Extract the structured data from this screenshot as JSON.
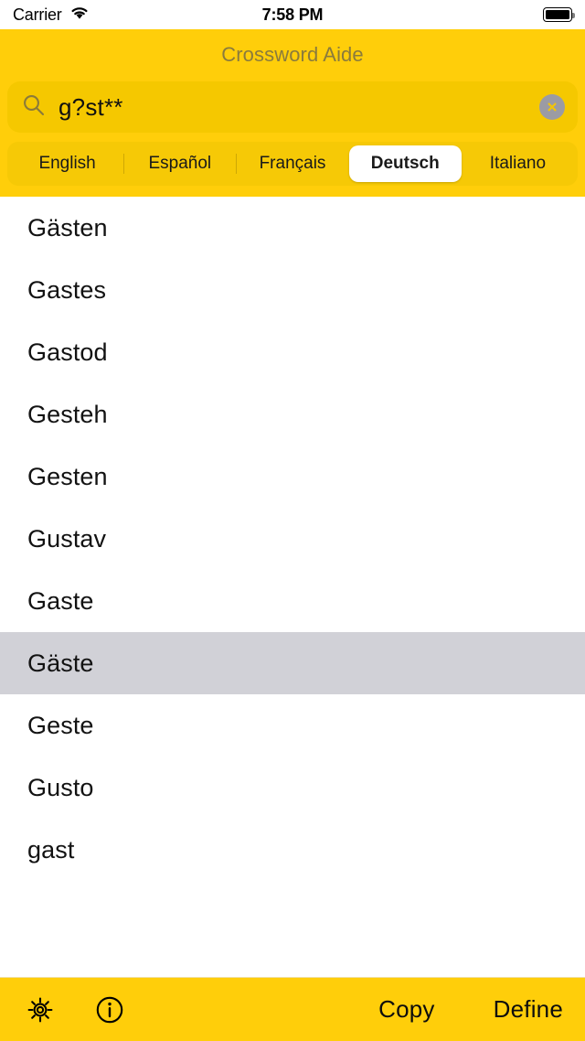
{
  "status_bar": {
    "carrier": "Carrier",
    "wifi_icon": "wifi-icon",
    "time": "7:58 PM",
    "battery_icon": "battery-full-icon"
  },
  "header": {
    "title": "Crossword Aide",
    "title_color": "#8a7b3d",
    "background_color": "#FFCE0A"
  },
  "search": {
    "icon": "search-icon",
    "value": "g?st**",
    "placeholder": "Search",
    "clear_icon": "clear-circle-icon",
    "field_color": "#F5C800"
  },
  "language_tabs": {
    "selected": "Deutsch",
    "items": [
      {
        "label": "English",
        "selected": false
      },
      {
        "label": "Español",
        "selected": false
      },
      {
        "label": "Français",
        "selected": false
      },
      {
        "label": "Deutsch",
        "selected": true
      },
      {
        "label": "Italiano",
        "selected": false
      }
    ]
  },
  "results": {
    "selected_index": 7,
    "selection_color": "#D1D1D7",
    "items": [
      {
        "word": "Gästen"
      },
      {
        "word": "Gastes"
      },
      {
        "word": "Gastod"
      },
      {
        "word": "Gesteh"
      },
      {
        "word": "Gesten"
      },
      {
        "word": "Gustav"
      },
      {
        "word": "Gaste"
      },
      {
        "word": "Gäste"
      },
      {
        "word": "Geste"
      },
      {
        "word": "Gusto"
      },
      {
        "word": "gast"
      }
    ]
  },
  "toolbar": {
    "settings_icon": "gear-icon",
    "info_icon": "info-circle-icon",
    "copy_label": "Copy",
    "define_label": "Define",
    "background_color": "#FFCE0A"
  }
}
